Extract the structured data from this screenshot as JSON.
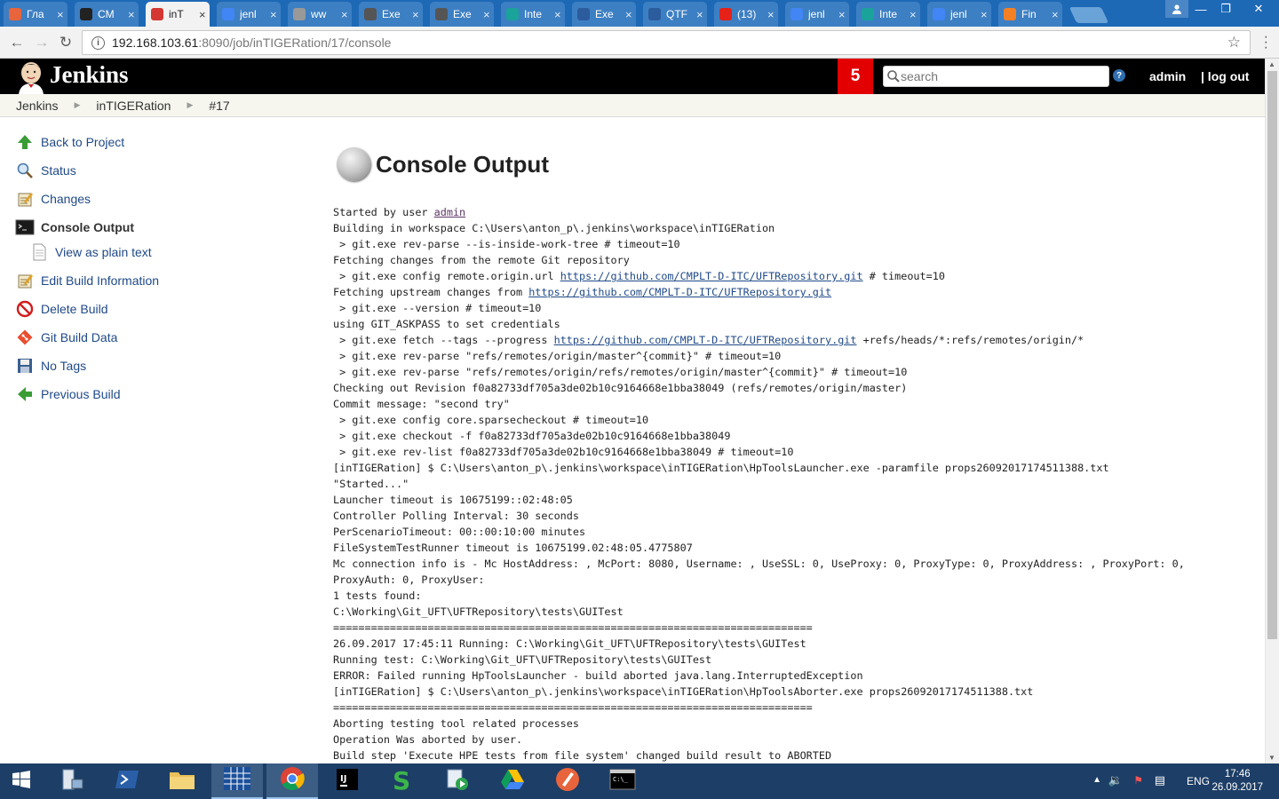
{
  "browser": {
    "tabs": [
      {
        "title": "Гла",
        "icon": "firefox-like-icon",
        "color": "#e8643c",
        "active": false
      },
      {
        "title": "CM",
        "icon": "github-icon",
        "color": "#222222",
        "active": false
      },
      {
        "title": "inT",
        "icon": "jenkins-icon",
        "color": "#d33833",
        "active": true
      },
      {
        "title": "jenl",
        "icon": "google-icon",
        "color": "#4285f4",
        "active": false
      },
      {
        "title": "ww",
        "icon": "google-icon",
        "color": "#999999",
        "active": false
      },
      {
        "title": "Exe",
        "icon": "doc-icon",
        "color": "#555555",
        "active": false
      },
      {
        "title": "Exe",
        "icon": "doc-icon",
        "color": "#555555",
        "active": false
      },
      {
        "title": "Inte",
        "icon": "teal-icon",
        "color": "#1aa39b",
        "active": false
      },
      {
        "title": "Exe",
        "icon": "grid-icon",
        "color": "#2b5c9e",
        "active": false
      },
      {
        "title": "QTF",
        "icon": "grid-icon",
        "color": "#2b5c9e",
        "active": false
      },
      {
        "title": "(13)",
        "icon": "youtube-icon",
        "color": "#e62117",
        "active": false
      },
      {
        "title": "jenl",
        "icon": "google-icon",
        "color": "#4285f4",
        "active": false
      },
      {
        "title": "Inte",
        "icon": "teal-icon",
        "color": "#1aa39b",
        "active": false
      },
      {
        "title": "jenl",
        "icon": "google-icon",
        "color": "#4285f4",
        "active": false
      },
      {
        "title": "Fin",
        "icon": "stackoverflow-icon",
        "color": "#f48024",
        "active": false
      }
    ],
    "url_host": "192.168.103.61",
    "url_path": ":8090/job/inTIGERation/17/console"
  },
  "jenkins": {
    "title": "Jenkins",
    "notifications": "5",
    "search_placeholder": "search",
    "user": "admin",
    "logout": "| log out"
  },
  "breadcrumb": [
    "Jenkins",
    "inTIGERation",
    "#17"
  ],
  "sidebar": [
    {
      "label": "Back to Project",
      "icon": "up-arrow-icon"
    },
    {
      "label": "Status",
      "icon": "magnifier-icon"
    },
    {
      "label": "Changes",
      "icon": "notepad-icon"
    },
    {
      "label": "Console Output",
      "icon": "terminal-icon",
      "current": true
    },
    {
      "label": "View as plain text",
      "icon": "document-icon",
      "sub": true
    },
    {
      "label": "Edit Build Information",
      "icon": "notepad-icon"
    },
    {
      "label": "Delete Build",
      "icon": "no-entry-icon"
    },
    {
      "label": "Git Build Data",
      "icon": "git-icon"
    },
    {
      "label": "No Tags",
      "icon": "floppy-icon"
    },
    {
      "label": "Previous Build",
      "icon": "left-arrow-icon"
    }
  ],
  "page_title": "Console Output",
  "console_lines": [
    [
      {
        "t": "Started by user "
      },
      {
        "t": "admin",
        "link": "visited"
      }
    ],
    [
      {
        "t": "Building in workspace C:\\Users\\anton_p\\.jenkins\\workspace\\inTIGERation"
      }
    ],
    [
      {
        "t": " > git.exe rev-parse --is-inside-work-tree # timeout=10"
      }
    ],
    [
      {
        "t": "Fetching changes from the remote Git repository"
      }
    ],
    [
      {
        "t": " > git.exe config remote.origin.url "
      },
      {
        "t": "https://github.com/CMPLT-D-ITC/UFTRepository.git",
        "link": "url"
      },
      {
        "t": " # timeout=10"
      }
    ],
    [
      {
        "t": "Fetching upstream changes from "
      },
      {
        "t": "https://github.com/CMPLT-D-ITC/UFTRepository.git",
        "link": "url"
      }
    ],
    [
      {
        "t": " > git.exe --version # timeout=10"
      }
    ],
    [
      {
        "t": "using GIT_ASKPASS to set credentials"
      }
    ],
    [
      {
        "t": " > git.exe fetch --tags --progress "
      },
      {
        "t": "https://github.com/CMPLT-D-ITC/UFTRepository.git",
        "link": "url"
      },
      {
        "t": " +refs/heads/*:refs/remotes/origin/*"
      }
    ],
    [
      {
        "t": " > git.exe rev-parse \"refs/remotes/origin/master^{commit}\" # timeout=10"
      }
    ],
    [
      {
        "t": " > git.exe rev-parse \"refs/remotes/origin/refs/remotes/origin/master^{commit}\" # timeout=10"
      }
    ],
    [
      {
        "t": "Checking out Revision f0a82733df705a3de02b10c9164668e1bba38049 (refs/remotes/origin/master)"
      }
    ],
    [
      {
        "t": "Commit message: \"second try\""
      }
    ],
    [
      {
        "t": " > git.exe config core.sparsecheckout # timeout=10"
      }
    ],
    [
      {
        "t": " > git.exe checkout -f f0a82733df705a3de02b10c9164668e1bba38049"
      }
    ],
    [
      {
        "t": " > git.exe rev-list f0a82733df705a3de02b10c9164668e1bba38049 # timeout=10"
      }
    ],
    [
      {
        "t": "[inTIGERation] $ C:\\Users\\anton_p\\.jenkins\\workspace\\inTIGERation\\HpToolsLauncher.exe -paramfile props26092017174511388.txt"
      }
    ],
    [
      {
        "t": "\"Started...\""
      }
    ],
    [
      {
        "t": "Launcher timeout is 10675199::02:48:05"
      }
    ],
    [
      {
        "t": "Controller Polling Interval: 30 seconds"
      }
    ],
    [
      {
        "t": "PerScenarioTimeout: 00::00:10:00 minutes"
      }
    ],
    [
      {
        "t": "FileSystemTestRunner timeout is 10675199.02:48:05.4775807"
      }
    ],
    [
      {
        "t": "Mc connection info is - Mc HostAddress: , McPort: 8080, Username: , UseSSL: 0, UseProxy: 0, ProxyType: 0, ProxyAddress: , ProxyPort: 0,"
      }
    ],
    [
      {
        "t": "ProxyAuth: 0, ProxyUser:"
      }
    ],
    [
      {
        "t": "1 tests found:"
      }
    ],
    [
      {
        "t": "C:\\Working\\Git_UFT\\UFTRepository\\tests\\GUITest"
      }
    ],
    [
      {
        "t": "============================================================================"
      }
    ],
    [
      {
        "t": "26.09.2017 17:45:11 Running: C:\\Working\\Git_UFT\\UFTRepository\\tests\\GUITest"
      }
    ],
    [
      {
        "t": "Running test: C:\\Working\\Git_UFT\\UFTRepository\\tests\\GUITest"
      }
    ],
    [
      {
        "t": "ERROR: Failed running HpToolsLauncher - build aborted java.lang.InterruptedException"
      }
    ],
    [
      {
        "t": "[inTIGERation] $ C:\\Users\\anton_p\\.jenkins\\workspace\\inTIGERation\\HpToolsAborter.exe props26092017174511388.txt"
      }
    ],
    [
      {
        "t": "============================================================================"
      }
    ],
    [
      {
        "t": "Aborting testing tool related processes"
      }
    ],
    [
      {
        "t": "Operation Was aborted by user."
      }
    ],
    [
      {
        "t": "Build step 'Execute HPE tests from file system' changed build result to ABORTED"
      }
    ]
  ],
  "taskbar": {
    "apps": [
      {
        "name": "start-button",
        "icon": "windows-icon"
      },
      {
        "name": "file-server-app",
        "icon": "server-icon"
      },
      {
        "name": "powershell-app",
        "icon": "powershell-icon"
      },
      {
        "name": "file-explorer-app",
        "icon": "folder-icon"
      },
      {
        "name": "spreadsheet-app",
        "icon": "grid-icon",
        "active": true
      },
      {
        "name": "chrome-app",
        "icon": "chrome-icon",
        "active": true
      },
      {
        "name": "intellij-app",
        "icon": "intellij-icon"
      },
      {
        "name": "skype-like-app",
        "icon": "green-s-icon"
      },
      {
        "name": "media-app",
        "icon": "play-icon"
      },
      {
        "name": "drive-app",
        "icon": "triangle-icon"
      },
      {
        "name": "draw-app",
        "icon": "pen-icon"
      },
      {
        "name": "cmd-app",
        "icon": "cmd-icon"
      }
    ],
    "lang": "ENG",
    "time": "17:46",
    "date": "26.09.2017"
  }
}
